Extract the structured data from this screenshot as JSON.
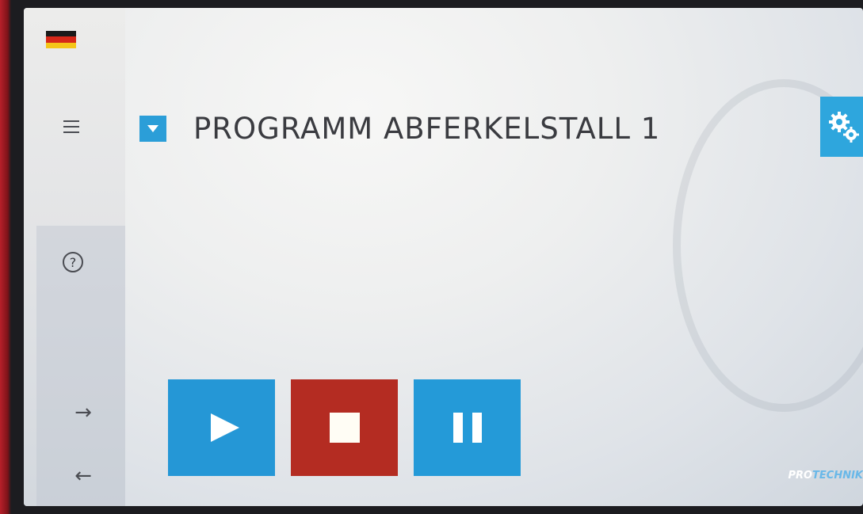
{
  "language": {
    "icon": "germany-flag-icon",
    "colors": [
      "#1a1a1a",
      "#d62718",
      "#f5c518"
    ]
  },
  "sidebar": {
    "menu_icon": "hamburger-menu-icon",
    "help_icon": "question-mark-icon",
    "help_glyph": "?",
    "forward_icon": "arrow-right-icon",
    "forward_glyph": "→",
    "back_icon": "arrow-left-icon",
    "back_glyph": "←"
  },
  "program": {
    "dropdown_icon": "dropdown-arrow-icon",
    "title": "PROGRAMM ABFERKELSTALL 1"
  },
  "settings": {
    "icon": "gears-icon",
    "color": "#2ea6dd"
  },
  "controls": {
    "play": {
      "icon": "play-icon",
      "color": "#2597d6"
    },
    "stop": {
      "icon": "stop-icon",
      "color": "#b42c22"
    },
    "pause": {
      "icon": "pause-icon",
      "color": "#249ad8"
    }
  },
  "brand": {
    "prefix": "PRO",
    "suffix": "TECHNIK"
  }
}
